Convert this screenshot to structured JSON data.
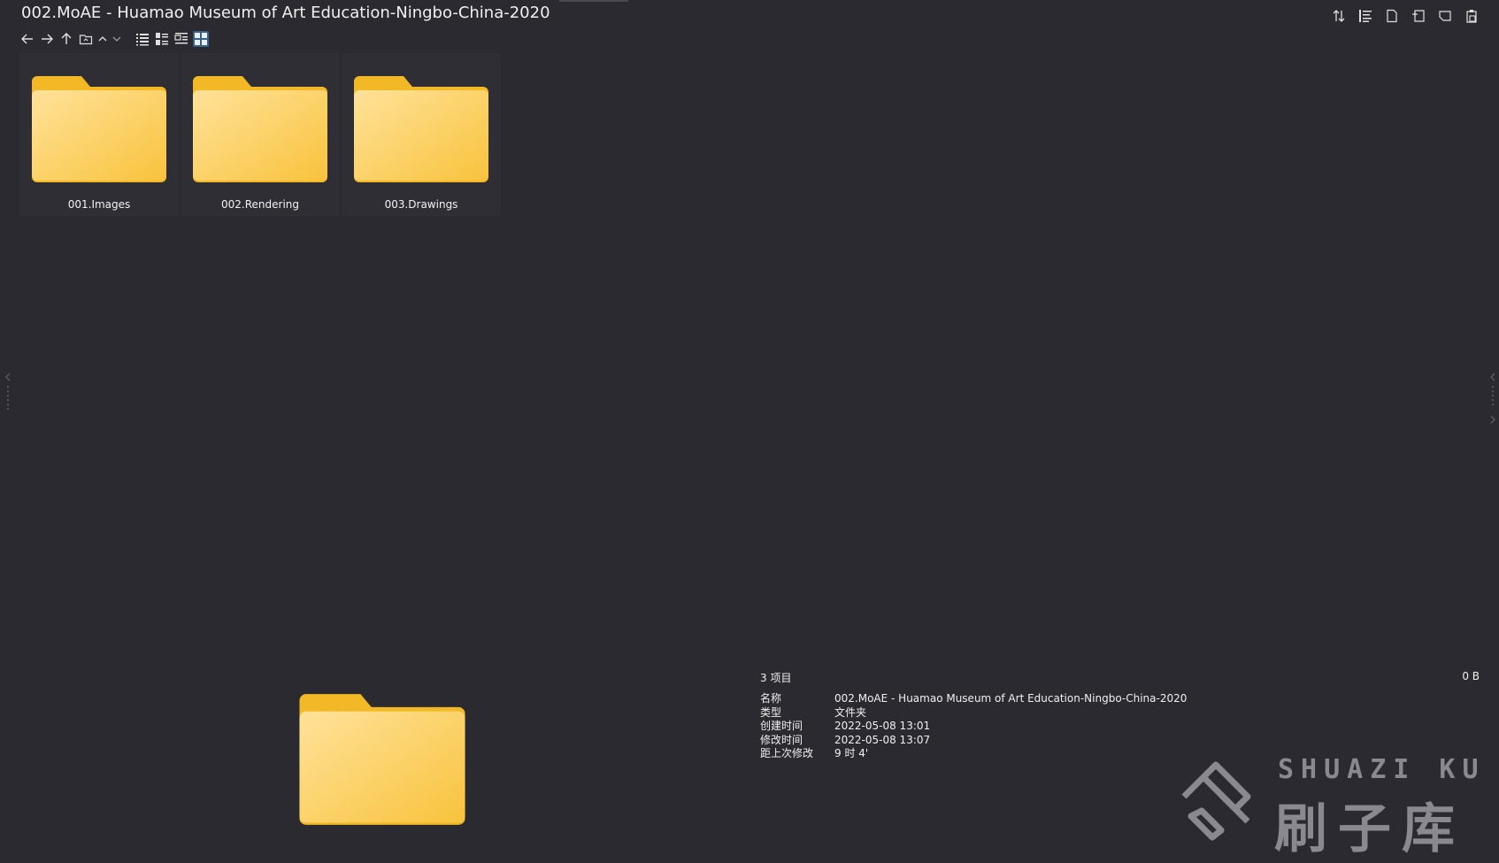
{
  "window": {
    "title": "002.MoAE - Huamao Museum of Art Education-Ningbo-China-2020"
  },
  "toolbar": {
    "icons": [
      "back-arrow-icon",
      "forward-arrow-icon",
      "up-arrow-icon",
      "folder-browse-icon",
      "chevron-up-icon",
      "chevron-down-icon",
      "list-view-icon",
      "details-view-icon",
      "tiles-view-icon",
      "large-icons-view-icon"
    ],
    "right_icons": [
      "sort-icon",
      "group-icon",
      "new-file-icon",
      "new-window-icon",
      "new-tab-icon",
      "paste-icon"
    ]
  },
  "folders": [
    {
      "name": "001.Images"
    },
    {
      "name": "002.Rendering"
    },
    {
      "name": "003.Drawings"
    }
  ],
  "info_panel": {
    "count": "3 项目",
    "size": "0 B",
    "rows": [
      {
        "key": "名称",
        "value": "002.MoAE - Huamao Museum of Art Education-Ningbo-China-2020"
      },
      {
        "key": "类型",
        "value": "文件夹"
      },
      {
        "key": "创建时间",
        "value": "2022-05-08  13:01"
      },
      {
        "key": "修改时间",
        "value": "2022-05-08  13:07"
      },
      {
        "key": "距上次修改",
        "value": "9 时 4'"
      }
    ]
  },
  "watermark": {
    "en": "SHUAZI KU",
    "cn": "刷子库"
  },
  "colors": {
    "background": "#2b2a30",
    "folder": "#f7c948",
    "selected": "#3a5f8a"
  }
}
